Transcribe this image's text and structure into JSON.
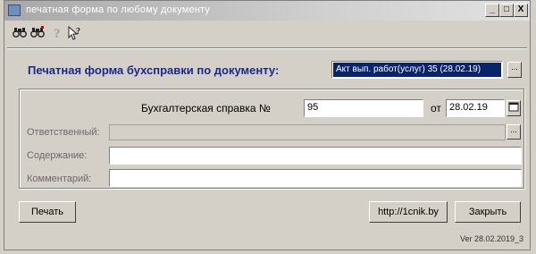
{
  "window": {
    "title": "печатная форма по любому документу",
    "controls": {
      "minimize": "_",
      "maximize": "□",
      "close": "X"
    }
  },
  "toolbar": {
    "icons": [
      "binoculars-icon",
      "binoculars-search-icon",
      "help-icon",
      "pointer-help-icon"
    ]
  },
  "main_label": "Печатная форма бухсправки по документу:",
  "document_field": {
    "value": "Акт вып. работ(услуг) 35 (28.02.19)"
  },
  "group": {
    "ref_label": "Бухгалтерская справка №",
    "ref_number": "95",
    "date_label": "от",
    "date_value": "28.02.19",
    "responsible_label": "Ответственный:",
    "responsible_value": "",
    "content_label": "Содержание:",
    "content_value": "",
    "comment_label": "Комментарий:",
    "comment_value": ""
  },
  "buttons": {
    "print": "Печать",
    "link": "http://1cnik.by",
    "close": "Закрыть",
    "select": "..."
  },
  "version": "Ver 28.02.2019_3"
}
